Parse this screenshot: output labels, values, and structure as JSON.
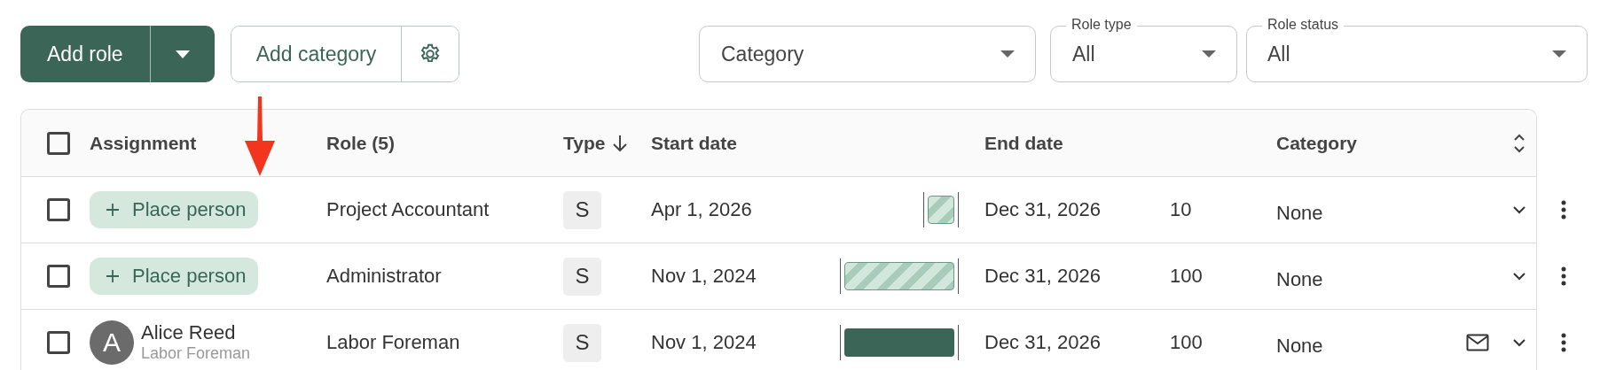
{
  "toolbar": {
    "add_role": {
      "label": "Add role"
    },
    "add_category": {
      "label": "Add category"
    }
  },
  "filters": [
    {
      "value": "Category"
    },
    {
      "label": "Role type",
      "value": "All"
    },
    {
      "label": "Role status",
      "value": "All"
    }
  ],
  "table": {
    "select_all": {
      "checked": false
    },
    "columns": [
      {
        "label": "Assignment",
        "sorted": false
      },
      {
        "label": "Role (5)",
        "sorted": false
      },
      {
        "label": "Type",
        "sorted": true
      },
      {
        "label": "Start date",
        "sorted": false
      },
      {
        "label": "End date",
        "sorted": false
      },
      {
        "label": "Category",
        "sorted": false
      }
    ],
    "rows": [
      {
        "checked": false,
        "assignment": {
          "kind": "placeholder",
          "label": "Place person"
        },
        "role": "Project Accountant",
        "type": "S",
        "start_date": "Apr 1, 2026",
        "bar": {
          "kind": "partial"
        },
        "end_date": "Dec 31, 2026",
        "column_6": "10",
        "category": "None",
        "has_email": false
      },
      {
        "checked": false,
        "assignment": {
          "kind": "placeholder",
          "label": "Place person"
        },
        "role": "Administrator",
        "type": "S",
        "start_date": "Nov 1, 2024",
        "bar": {
          "kind": "full"
        },
        "end_date": "Dec 31, 2026",
        "column_6": "100",
        "category": "None",
        "has_email": false
      },
      {
        "checked": false,
        "assignment": {
          "kind": "person",
          "initial": "A",
          "name": "Alice Reed",
          "subtitle": "Labor Foreman"
        },
        "role": "Labor Foreman",
        "type": "S",
        "start_date": "Nov 1, 2024",
        "bar": {
          "kind": "full"
        },
        "end_date": "Dec 31, 2026",
        "column_6": "100",
        "category": "None",
        "has_email": true
      }
    ]
  },
  "pointer_arrow": true
}
